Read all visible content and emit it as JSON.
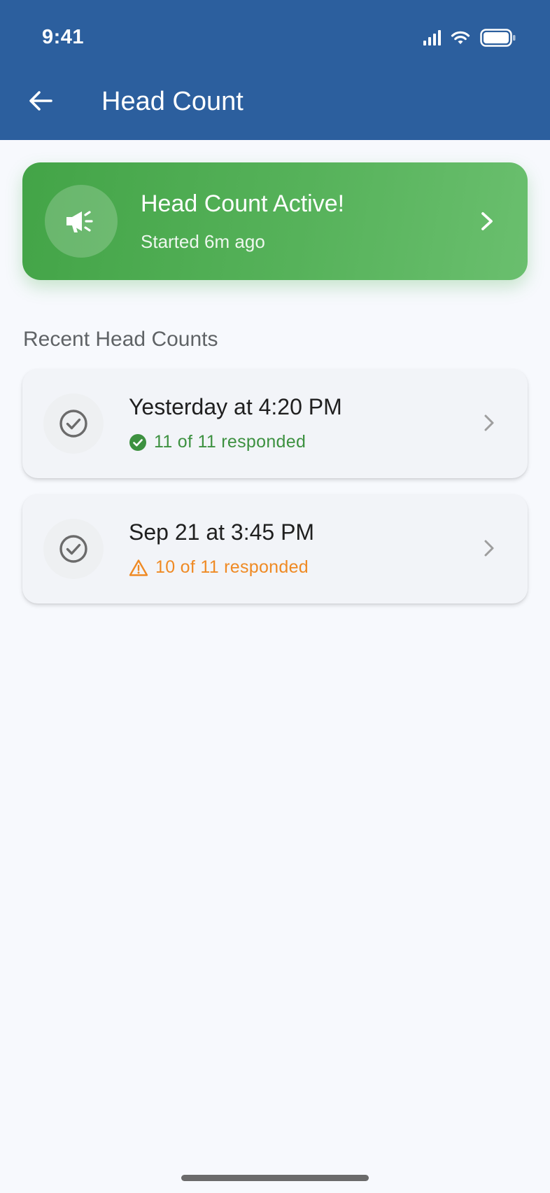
{
  "status_bar": {
    "time": "9:41",
    "icons": [
      "signal-icon",
      "wifi-icon",
      "battery-icon"
    ]
  },
  "header": {
    "title": "Head Count",
    "back_icon": "arrow-left-icon"
  },
  "active_banner": {
    "title": "Head Count Active!",
    "subtitle": "Started 6m ago",
    "icon": "megaphone-icon"
  },
  "recent": {
    "section_title": "Recent Head Counts",
    "items": [
      {
        "title": "Yesterday at 4:20 PM",
        "status": "11 of 11 responded",
        "status_icon": "check-circle-icon",
        "status_color": "#3d9140"
      },
      {
        "title": "Sep 21 at 3:45 PM",
        "status": "10 of 11 responded",
        "status_icon": "warning-icon",
        "status_color": "#ef8a24"
      }
    ]
  },
  "colors": {
    "header": "#2c5f9e",
    "active_green": "#4caf50",
    "success": "#3d9140",
    "warning": "#ef8a24"
  }
}
